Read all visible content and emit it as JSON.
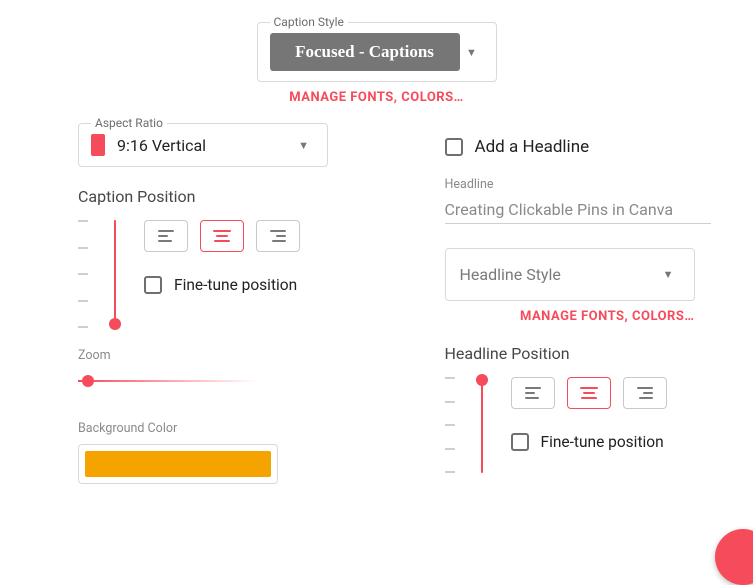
{
  "caption_style": {
    "label": "Caption Style",
    "selected": "Focused - Captions",
    "manage": "MANAGE FONTS, COLORS…"
  },
  "aspect_ratio": {
    "label": "Aspect Ratio",
    "selected": "9:16 Vertical"
  },
  "caption_position": {
    "title": "Caption Position",
    "fine_tune": "Fine-tune position"
  },
  "zoom": {
    "label": "Zoom"
  },
  "background_color": {
    "label": "Background Color",
    "value": "#f5a300"
  },
  "headline": {
    "add_label": "Add a Headline",
    "field_label": "Headline",
    "value": "Creating Clickable Pins in Canva",
    "style_label": "Headline Style",
    "manage": "MANAGE FONTS, COLORS…",
    "position_title": "Headline Position",
    "fine_tune": "Fine-tune position"
  }
}
